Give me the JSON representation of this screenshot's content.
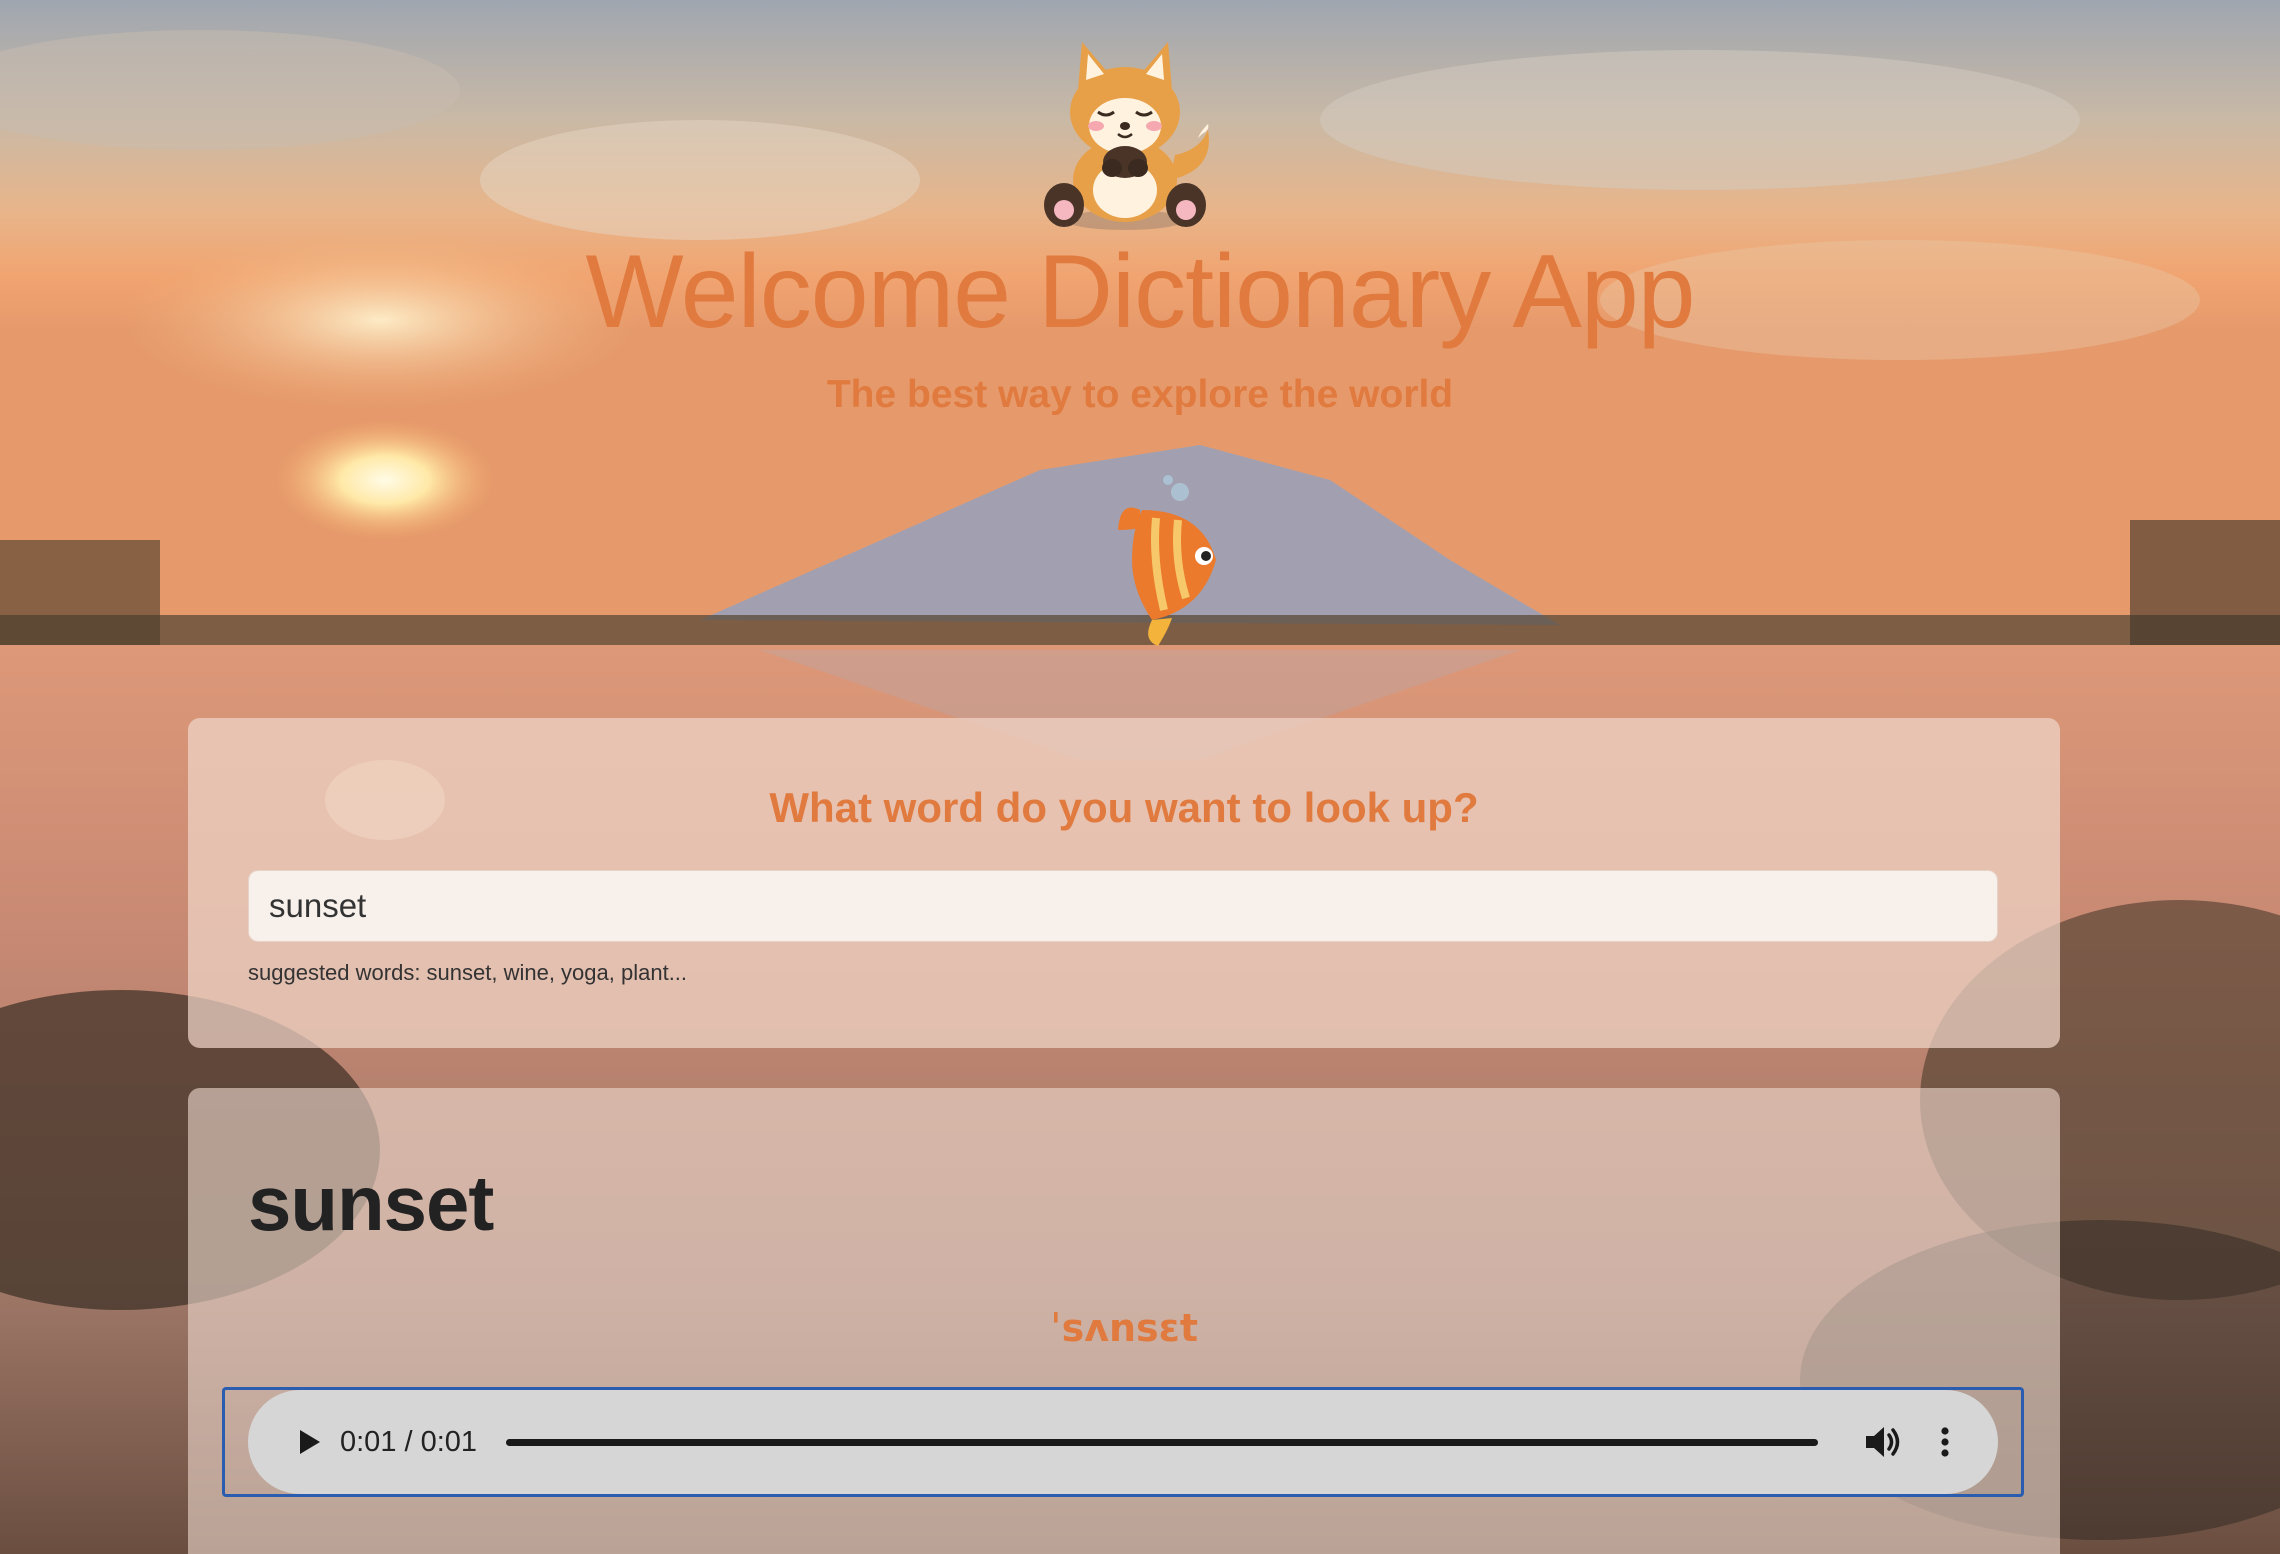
{
  "header": {
    "title": "Welcome Dictionary App",
    "subtitle": "The best way to explore the world"
  },
  "search": {
    "question": "What word do you want to look up?",
    "input_value": "sunset",
    "suggestions_hint": "suggested words: sunset, wine, yoga, plant..."
  },
  "result": {
    "word": "sunset",
    "phonetic": "ˈsʌnsɛt",
    "audio": {
      "time_display": "0:01 / 0:01",
      "progress": 1.0
    }
  },
  "icons": {
    "logo": "fox-mascot-icon",
    "decoration": "fish-icon",
    "play": "play-icon",
    "volume": "volume-icon",
    "more": "more-options-icon"
  },
  "colors": {
    "accent": "#e07a3e",
    "focus_ring": "#2a5cb0",
    "text_dark": "#222222"
  }
}
